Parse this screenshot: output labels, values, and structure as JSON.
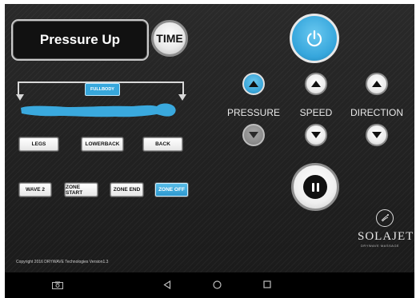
{
  "display": {
    "mode_text": "Pressure Up"
  },
  "time_button": {
    "label": "TIME"
  },
  "body_map": {
    "fullbody_label": "FULLBODY"
  },
  "zones": [
    "LEGS",
    "LOWERBACK",
    "BACK"
  ],
  "program_buttons": [
    {
      "label": "WAVE 2",
      "active": false
    },
    {
      "label": "ZONE START",
      "active": false
    },
    {
      "label": "ZONE END",
      "active": false
    },
    {
      "label": "ZONE OFF",
      "active": true
    }
  ],
  "controls": {
    "pressure": {
      "label": "PRESSURE"
    },
    "speed": {
      "label": "SPEED"
    },
    "direction": {
      "label": "DIRECTION"
    }
  },
  "brand": {
    "name": "SOLAJET",
    "tagline": "DRYWAVE MASSAGE"
  },
  "copyright": "Copyright 2016 DRYWAVE Technologies Version1.3",
  "icons": {
    "power": "power-icon",
    "pause": "pause-icon",
    "recents": "screenshot-icon",
    "back": "nav-back-icon",
    "home": "nav-home-icon",
    "overview": "nav-recents-icon"
  },
  "colors": {
    "accent": "#37a7dc",
    "background": "#222222"
  }
}
